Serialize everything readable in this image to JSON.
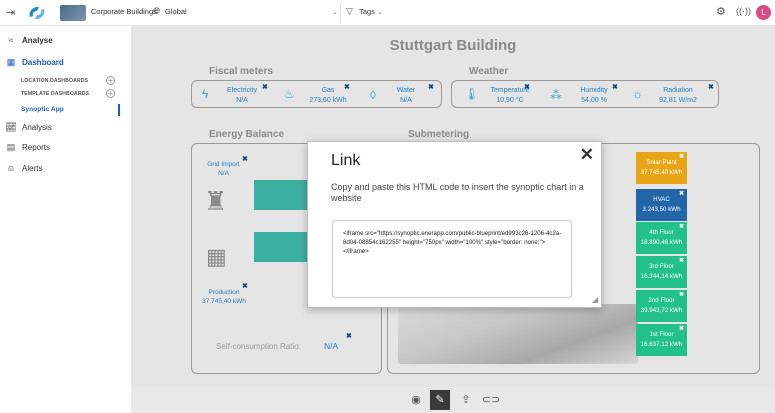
{
  "topbar": {
    "location": "Corporate Buildings",
    "scope": "Global",
    "tags": "Tags",
    "avatar_letter": "L"
  },
  "sidebar": {
    "analyse": "Analyse",
    "dashboard": "Dashboard",
    "location_dashboards": "LOCATION DASHBOARDS",
    "template_dashboards": "TEMPLATE DASHBOARDS",
    "synoptic_app": "Synoptic App",
    "analysis": "Analysis",
    "reports": "Reports",
    "alerts": "Alerts"
  },
  "synoptic": {
    "title": "Stuttgart Building",
    "fiscal_title": "Fiscal meters",
    "weather_title": "Weather",
    "energy_title": "Energy Balance",
    "submetering_title": "Submetering",
    "fiscal": [
      {
        "label": "Electricity",
        "value": "N/A"
      },
      {
        "label": "Gas",
        "value": "273,60 kWh"
      },
      {
        "label": "Water",
        "value": "N/A"
      }
    ],
    "weather": [
      {
        "label": "Temperature",
        "value": "10,90 °C"
      },
      {
        "label": "Humidity",
        "value": "54,00 %"
      },
      {
        "label": "Radiation",
        "value": "92,81 W/m2"
      }
    ],
    "grid_import_label": "Grid Import",
    "grid_import_value": "N/A",
    "production_label": "Production",
    "production_value": "37.745,40 kWh",
    "self_consumption_label": "Self-consumption Ratio:",
    "self_consumption_value": "N/A",
    "floors": [
      {
        "label": "Solar Plant",
        "value": "37.745,40 kWh",
        "color": "#e8a617"
      },
      {
        "label": "HVAC",
        "value": "3.243,50 kWh",
        "color": "#2366a8"
      },
      {
        "label": "4th Floor",
        "value": "18.890,46 kWh",
        "color": "#22c08a"
      },
      {
        "label": "3rd Floor",
        "value": "16.344,14 kWh",
        "color": "#22c08a"
      },
      {
        "label": "2nd Floor",
        "value": "39.943,72 kWh",
        "color": "#22c08a"
      },
      {
        "label": "1st Floor",
        "value": "16.637,12 kWh",
        "color": "#22c08a"
      }
    ]
  },
  "modal": {
    "title": "Link",
    "description": "Copy and paste this HTML code to insert the synoptic chart in a website",
    "code": "<iframe src=\"https://synoptic.enerapp.com/public-blueprint/ed993c26-1206-4c2a-8d04-08854c162255\" height=\"750px\" width=\"100%\" style=\"border: none;\"></iframe>"
  },
  "icons": {
    "collapse": "menu-collapse-icon",
    "logo": "enerapp-logo",
    "globe": "globe-icon",
    "filter": "filter-icon",
    "settings": "gear-icon",
    "notifications": "broadcast-icon",
    "view": "eye-icon",
    "edit": "pencil-icon",
    "upload": "upload-icon",
    "link": "link-icon"
  },
  "colors": {
    "accent": "#1a5cc9",
    "value_blue": "#2680c2",
    "pipe_teal": "#3cb0a0",
    "avatar": "#d94a84"
  }
}
